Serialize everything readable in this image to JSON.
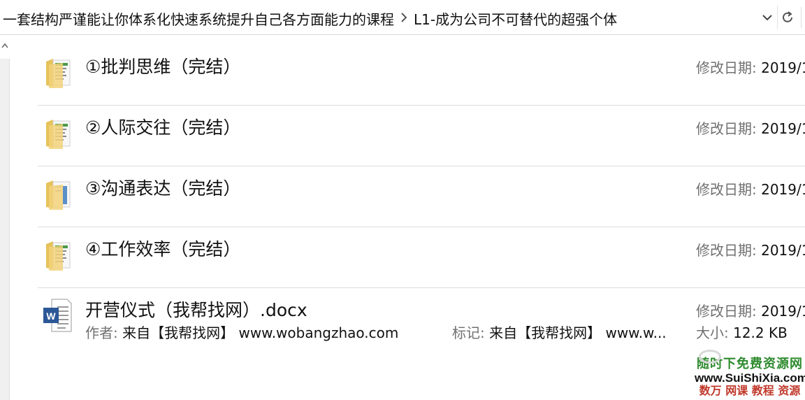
{
  "address_bar": {
    "breadcrumbs": [
      "一套结构严谨能让你体系化快速系统提升自己各方面能力的课程",
      "L1-成为公司不可替代的超强个体"
    ],
    "separator_icon": "chevron-right-icon",
    "dropdown_icon": "chevron-down-icon",
    "refresh_icon": "refresh-icon"
  },
  "files": [
    {
      "name": "①批判思维（完结）",
      "type": "folder",
      "icon": "folder-icon",
      "date_label": "修改日期:",
      "date_value": "2019/1"
    },
    {
      "name": "②人际交往（完结）",
      "type": "folder",
      "icon": "folder-icon",
      "date_label": "修改日期:",
      "date_value": "2019/1"
    },
    {
      "name": "③沟通表达（完结）",
      "type": "folder",
      "icon": "folder-icon",
      "date_label": "修改日期:",
      "date_value": "2019/1"
    },
    {
      "name": "④工作效率（完结）",
      "type": "folder",
      "icon": "folder-icon",
      "date_label": "修改日期:",
      "date_value": "2019/1"
    },
    {
      "name": "开营仪式（我帮找网）.docx",
      "type": "docx",
      "icon": "word-document-icon",
      "date_label": "修改日期:",
      "date_value": "2019/1",
      "author_label": "作者:",
      "author_value": "来自【我帮找网】 www.wobangzhao.com",
      "tag_label": "标记:",
      "tag_value": "来自【我帮找网】 www.w...",
      "size_label": "大小:",
      "size_value": "12.2 KB"
    }
  ],
  "watermark": {
    "line1": "随时下免费资源网",
    "line2": "www.SuiShiXia.com",
    "line3": "数万 网课 教程 资源"
  }
}
